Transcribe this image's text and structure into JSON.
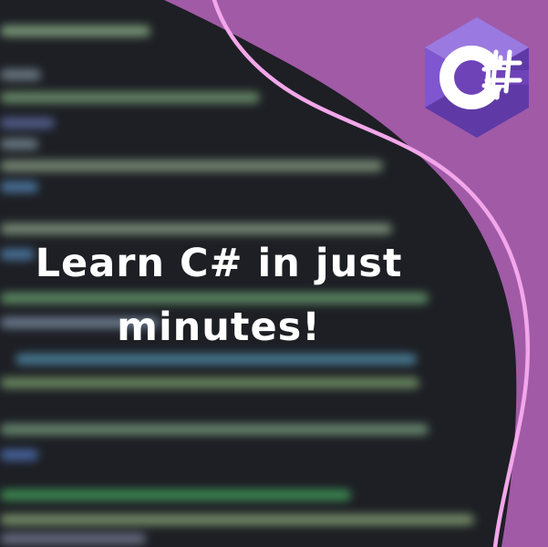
{
  "headline": "Learn C# in just\nminutes!",
  "logo": {
    "icon": "csharp-logo-icon",
    "letter": "C",
    "symbol": "#"
  },
  "colors": {
    "background": "#1d1f24",
    "purple": "#a15aa6",
    "pink_line": "#f3a7ea",
    "logo_light": "#7f56cf",
    "logo_mid": "#6c3fb6",
    "logo_dark": "#4b2688",
    "text": "#ffffff"
  }
}
